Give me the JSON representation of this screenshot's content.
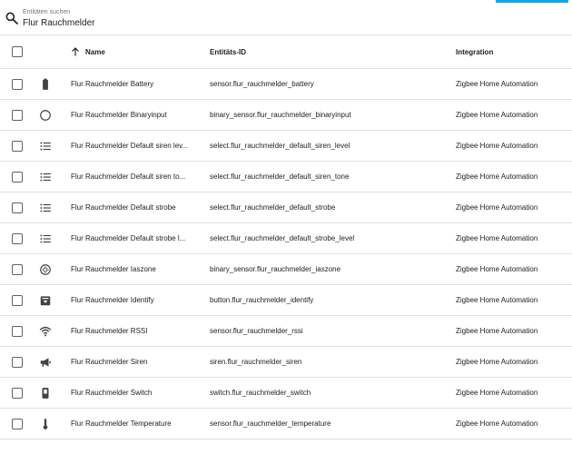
{
  "search": {
    "label": "Entitäten suchen",
    "value": "Flur Rauchmelder"
  },
  "columns": {
    "name": "Name",
    "entity_id": "Entitäts-ID",
    "integration": "Integration"
  },
  "rows": [
    {
      "icon": "battery-icon",
      "name": "Flur Rauchmelder Battery",
      "entity_id": "sensor.flur_rauchmelder_battery",
      "integration": "Zigbee Home Automation"
    },
    {
      "icon": "circle-outline-icon",
      "name": "Flur Rauchmelder Binaryinput",
      "entity_id": "binary_sensor.flur_rauchmelder_binaryinput",
      "integration": "Zigbee Home Automation"
    },
    {
      "icon": "list-icon",
      "name": "Flur Rauchmelder Default siren lev...",
      "entity_id": "select.flur_rauchmelder_default_siren_level",
      "integration": "Zigbee Home Automation"
    },
    {
      "icon": "list-icon",
      "name": "Flur Rauchmelder Default siren to...",
      "entity_id": "select.flur_rauchmelder_default_siren_tone",
      "integration": "Zigbee Home Automation"
    },
    {
      "icon": "list-icon",
      "name": "Flur Rauchmelder Default strobe",
      "entity_id": "select.flur_rauchmelder_default_strobe",
      "integration": "Zigbee Home Automation"
    },
    {
      "icon": "list-icon",
      "name": "Flur Rauchmelder Default strobe l...",
      "entity_id": "select.flur_rauchmelder_default_strobe_level",
      "integration": "Zigbee Home Automation"
    },
    {
      "icon": "smoke-detector-icon",
      "name": "Flur Rauchmelder Iaszone",
      "entity_id": "binary_sensor.flur_rauchmelder_iaszone",
      "integration": "Zigbee Home Automation"
    },
    {
      "icon": "button-icon",
      "name": "Flur Rauchmelder Identify",
      "entity_id": "button.flur_rauchmelder_identify",
      "integration": "Zigbee Home Automation"
    },
    {
      "icon": "wifi-icon",
      "name": "Flur Rauchmelder RSSI",
      "entity_id": "sensor.flur_rauchmelder_rssi",
      "integration": "Zigbee Home Automation"
    },
    {
      "icon": "bullhorn-icon",
      "name": "Flur Rauchmelder Siren",
      "entity_id": "siren.flur_rauchmelder_siren",
      "integration": "Zigbee Home Automation"
    },
    {
      "icon": "switch-icon",
      "name": "Flur Rauchmelder Switch",
      "entity_id": "switch.flur_rauchmelder_switch",
      "integration": "Zigbee Home Automation"
    },
    {
      "icon": "thermometer-icon",
      "name": "Flur Rauchmelder Temperature",
      "entity_id": "sensor.flur_rauchmelder_temperature",
      "integration": "Zigbee Home Automation"
    }
  ],
  "colors": {
    "accent": "#03a9f4",
    "icon": "#424242",
    "divider": "#e0e0e0"
  }
}
